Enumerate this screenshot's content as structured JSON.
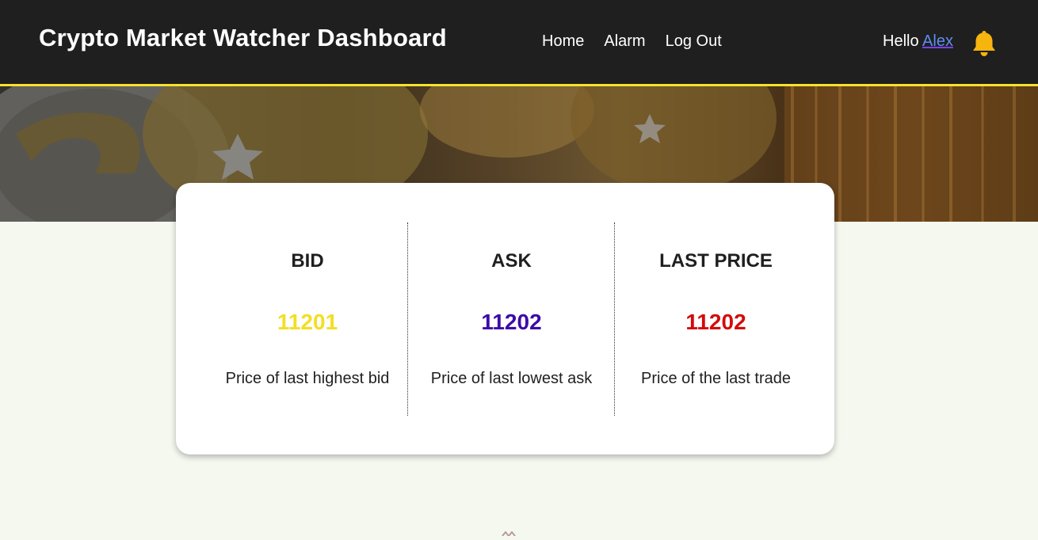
{
  "header": {
    "title": "Crypto Market Watcher Dashboard",
    "nav": [
      {
        "label": "Home"
      },
      {
        "label": "Alarm"
      },
      {
        "label": "Log Out"
      }
    ],
    "greeting_prefix": "Hello",
    "username": "Alex",
    "notification_icon": "bell-icon",
    "accent_color": "#f5e22c"
  },
  "stats": [
    {
      "label": "BID",
      "value": "11201",
      "description": "Price of last highest bid",
      "color": "#f2df22"
    },
    {
      "label": "ASK",
      "value": "11202",
      "description": "Price of last lowest ask",
      "color": "#3d0aa6"
    },
    {
      "label": "LAST PRICE",
      "value": "11202",
      "description": "Price of the last trade",
      "color": "#d40b0b"
    }
  ]
}
